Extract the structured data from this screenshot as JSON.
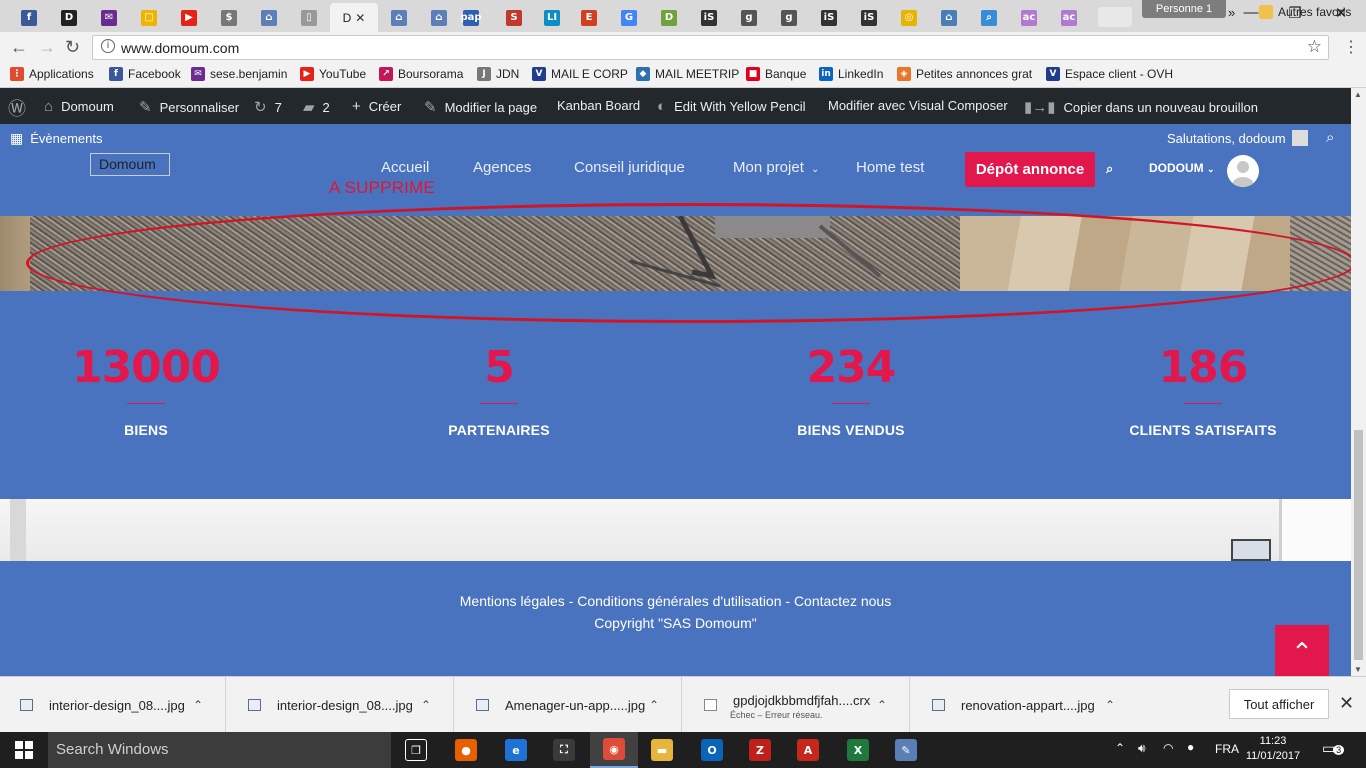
{
  "browser": {
    "profile_label": "Personne 1",
    "active_tab_letter": "D",
    "tabs": [
      {
        "icon": "facebook-icon",
        "letter": "f",
        "color": "#3b5998"
      },
      {
        "icon": "d-icon",
        "letter": "D",
        "color": "#222222"
      },
      {
        "icon": "mail-icon",
        "letter": "✉",
        "color": "#6a2c91"
      },
      {
        "icon": "bookmark-icon",
        "letter": "□",
        "color": "#f0b400"
      },
      {
        "icon": "youtube-icon",
        "letter": "▶",
        "color": "#e62117"
      },
      {
        "icon": "audio-icon",
        "letter": "$",
        "color": "#777777"
      },
      {
        "icon": "house-icon",
        "letter": "⌂",
        "color": "#5c7fb8"
      },
      {
        "icon": "page-icon",
        "letter": "▯",
        "color": "#999999"
      },
      {
        "icon": "house-icon",
        "letter": "⌂",
        "color": "#5c7fb8"
      },
      {
        "icon": "house-icon",
        "letter": "⌂",
        "color": "#5c7fb8"
      },
      {
        "icon": "pap-icon",
        "letter": "pap",
        "color": "#2f5fb0"
      },
      {
        "icon": "s-icon",
        "letter": "S",
        "color": "#c0392b"
      },
      {
        "icon": "li-icon",
        "letter": "LI",
        "color": "#0a8fc7"
      },
      {
        "icon": "e-icon",
        "letter": "E",
        "color": "#d04020"
      },
      {
        "icon": "google-icon",
        "letter": "G",
        "color": "#4285f4"
      },
      {
        "icon": "d-green-icon",
        "letter": "D",
        "color": "#6da33a"
      },
      {
        "icon": "is-icon",
        "letter": "iS",
        "color": "#333333"
      },
      {
        "icon": "g-icon",
        "letter": "g",
        "color": "#555555"
      },
      {
        "icon": "g-icon",
        "letter": "g",
        "color": "#555555"
      },
      {
        "icon": "is-icon",
        "letter": "iS",
        "color": "#333333"
      },
      {
        "icon": "is-icon",
        "letter": "iS",
        "color": "#333333"
      },
      {
        "icon": "shield-icon",
        "letter": "◎",
        "color": "#e8b400"
      },
      {
        "icon": "house-icon",
        "letter": "⌂",
        "color": "#4a7fb5"
      },
      {
        "icon": "search-icon",
        "letter": "⌕",
        "color": "#3a8bd8"
      },
      {
        "icon": "ac-icon",
        "letter": "ac",
        "color": "#b07ad0"
      },
      {
        "icon": "ac-icon",
        "letter": "ac",
        "color": "#b07ad0"
      }
    ],
    "window_controls": {
      "minimize": "—",
      "maximize": "❐",
      "close": "✕"
    },
    "url": "www.domoum.com"
  },
  "bookmarks": [
    {
      "label": "Applications",
      "icon": "apps-grid-icon",
      "color": "#e04a2f",
      "glyph": "⋮"
    },
    {
      "label": "Facebook",
      "icon": "facebook-icon",
      "color": "#3b5998",
      "glyph": "f"
    },
    {
      "label": "sese.benjamin",
      "icon": "mail-icon",
      "color": "#6a2c91",
      "glyph": "✉"
    },
    {
      "label": "YouTube",
      "icon": "youtube-icon",
      "color": "#e62117",
      "glyph": "▶"
    },
    {
      "label": "Boursorama",
      "icon": "boursorama-icon",
      "color": "#c2185b",
      "glyph": "↗"
    },
    {
      "label": "JDN",
      "icon": "jdn-icon",
      "color": "#777777",
      "glyph": "J"
    },
    {
      "label": "MAIL E CORP",
      "icon": "ovh-icon",
      "color": "#1f3d8a",
      "glyph": "V"
    },
    {
      "label": "MAIL MEETRIP",
      "icon": "meetrip-icon",
      "color": "#2e6fb0",
      "glyph": "◆"
    },
    {
      "label": "Banque",
      "icon": "bank-icon",
      "color": "#e2001a",
      "glyph": "■"
    },
    {
      "label": "LinkedIn",
      "icon": "linkedin-icon",
      "color": "#0a66c2",
      "glyph": "in"
    },
    {
      "label": "Petites annonces grat",
      "icon": "box-icon",
      "color": "#e8752a",
      "glyph": "◈"
    },
    {
      "label": "Espace client - OVH",
      "icon": "ovh-icon",
      "color": "#1f3d8a",
      "glyph": "V"
    }
  ],
  "bookmarks_more": "»",
  "other_bookmarks": "Autres favoris",
  "admin_bar": {
    "site_name": "Domoum",
    "customize": "Personnaliser",
    "updates_count": "7",
    "comments_count": "2",
    "new_label": "Créer",
    "edit_page": "Modifier la page",
    "kanban": "Kanban Board",
    "yellow_pencil": "Edit With Yellow Pencil",
    "visual_composer": "Modifier avec Visual Composer",
    "copy_draft": "Copier dans un nouveau brouillon"
  },
  "site": {
    "events_label": "Évènements",
    "greeting": "Salutations, dodoum",
    "logo_alt": "Domoum",
    "nav": [
      "Accueil",
      "Agences",
      "Conseil juridique",
      "Mon projet",
      "Home test"
    ],
    "warning_text": "A SUPPRIME",
    "depot_button": "Dépôt annonce",
    "user_label": "DODOUM",
    "stats": [
      {
        "value": "13000",
        "label": "BIENS"
      },
      {
        "value": "5",
        "label": "PARTENAIRES"
      },
      {
        "value": "234",
        "label": "BIENS VENDUS"
      },
      {
        "value": "186",
        "label": "CLIENTS SATISFAITS"
      }
    ],
    "footer_links": "Mentions légales - Conditions générales d'utilisation - Contactez nous",
    "copyright": "Copyright \"SAS Domoum\"",
    "accent_color": "#e2184d",
    "background_color": "#4a73bf"
  },
  "downloads": {
    "items": [
      {
        "name": "interior-design_08....jpg",
        "sub": ""
      },
      {
        "name": "interior-design_08....jpg",
        "sub": ""
      },
      {
        "name": "Amenager-un-app.....jpg",
        "sub": ""
      },
      {
        "name": "gpdjojdkbbmdfjfah....crx",
        "sub": "Échec – Erreur réseau."
      },
      {
        "name": "renovation-appart....jpg",
        "sub": ""
      }
    ],
    "show_all": "Tout afficher"
  },
  "taskbar": {
    "search_placeholder": "Search Windows",
    "language": "FRA",
    "time": "11:23",
    "date": "11/01/2017",
    "notifications": "3",
    "apps": [
      {
        "icon": "task-view-icon",
        "glyph": "❐",
        "color": "#1f1f1f"
      },
      {
        "icon": "firefox-icon",
        "glyph": "●",
        "color": "#e66000"
      },
      {
        "icon": "edge-icon",
        "glyph": "e",
        "color": "#1e72d6"
      },
      {
        "icon": "store-icon",
        "glyph": "⛶",
        "color": "#3a3a3a"
      },
      {
        "icon": "chrome-icon",
        "glyph": "◉",
        "color": "#dd4b39"
      },
      {
        "icon": "explorer-icon",
        "glyph": "▬",
        "color": "#e7b53c"
      },
      {
        "icon": "outlook-icon",
        "glyph": "O",
        "color": "#0a64b8"
      },
      {
        "icon": "filezilla-icon",
        "glyph": "Z",
        "color": "#c0201b"
      },
      {
        "icon": "acrobat-icon",
        "glyph": "A",
        "color": "#c6261c"
      },
      {
        "icon": "excel-icon",
        "glyph": "X",
        "color": "#1e7a3c"
      },
      {
        "icon": "paint-icon",
        "glyph": "✎",
        "color": "#5a7fb5"
      }
    ]
  }
}
